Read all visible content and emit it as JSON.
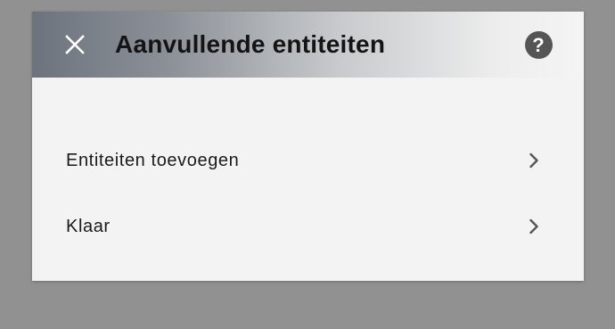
{
  "dialog": {
    "title": "Aanvullende entiteiten",
    "close_icon": "close-icon",
    "help_icon": "help-icon",
    "help_glyph": "?"
  },
  "menu": {
    "items": [
      {
        "label": "Entiteiten toevoegen",
        "icon": "chevron-right-icon"
      },
      {
        "label": "Klaar",
        "icon": "chevron-right-icon"
      }
    ]
  },
  "colors": {
    "page_background": "#919191",
    "dialog_background": "#f3f3f3",
    "header_gradient_start": "#6d737d",
    "header_gradient_end": "#f4f4f4",
    "text": "#1a1a1a",
    "icon": "#555555"
  }
}
